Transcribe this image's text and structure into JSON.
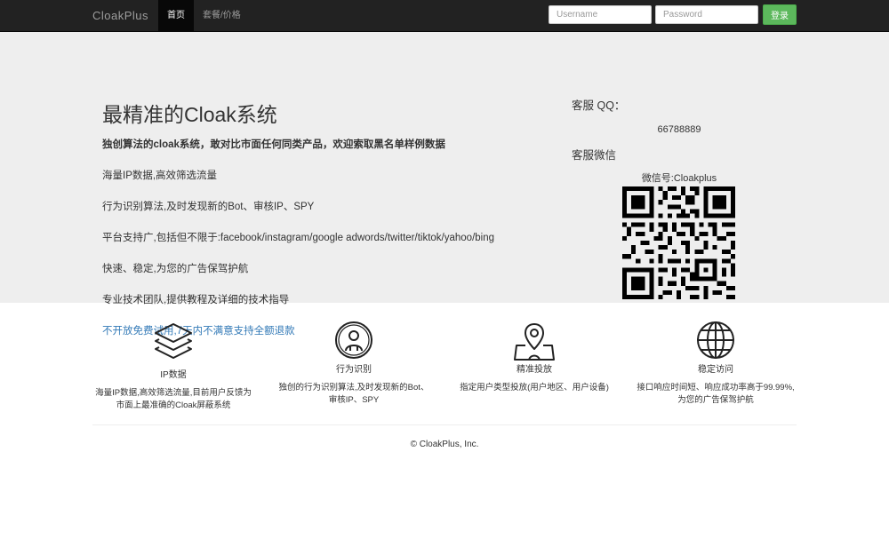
{
  "navbar": {
    "brand": "CloakPlus",
    "links": [
      {
        "label": "首页",
        "active": true
      },
      {
        "label": "套餐/价格",
        "active": false
      }
    ],
    "username_placeholder": "Username",
    "password_placeholder": "Password",
    "login_label": "登录"
  },
  "hero": {
    "title": "最精准的Cloak系统",
    "lead": "独创算法的cloak系统，敢对比市面任何同类产品，欢迎索取黑名单样例数据",
    "lines": [
      "海量IP数据,高效筛选流量",
      "行为识别算法,及时发现新的Bot、审核IP、SPY",
      "平台支持广,包括但不限于:facebook/instagram/google adwords/twitter/tiktok/yahoo/bing",
      "快速、稳定,为您的广告保驾护航",
      "专业技术团队,提供教程及详细的技术指导"
    ],
    "highlight": "不开放免费试用,7天内不满意支持全额退款"
  },
  "contact": {
    "qq_label": "客服 QQ：",
    "qq_value": "66788889",
    "wechat_label": "客服微信",
    "wechat_value": "微信号:Cloakplus"
  },
  "features": [
    {
      "icon": "layers-icon",
      "title": "IP数据",
      "desc1": "海量IP数据,高效筛选流量,目前用户反馈为",
      "desc2": "市面上最准确的Cloak屏蔽系统"
    },
    {
      "icon": "user-circle-icon",
      "title": "行为识别",
      "desc1": "独创的行为识别算法,及时发现新的Bot、",
      "desc2": "审核IP、SPY"
    },
    {
      "icon": "map-pin-icon",
      "title": "精准投放",
      "desc1": "指定用户类型投放(用户地区、用户设备)",
      "desc2": ""
    },
    {
      "icon": "globe-icon",
      "title": "稳定访问",
      "desc1": "接口响应时间短、响应成功率高于99.99%,",
      "desc2": "为您的广告保驾护航"
    }
  ],
  "footer": {
    "copyright": "© CloakPlus, Inc."
  },
  "colors": {
    "navbar_bg": "#222222",
    "jumbotron_bg": "#eeeeee",
    "login_button": "#5cb85c",
    "link": "#337ab7"
  }
}
